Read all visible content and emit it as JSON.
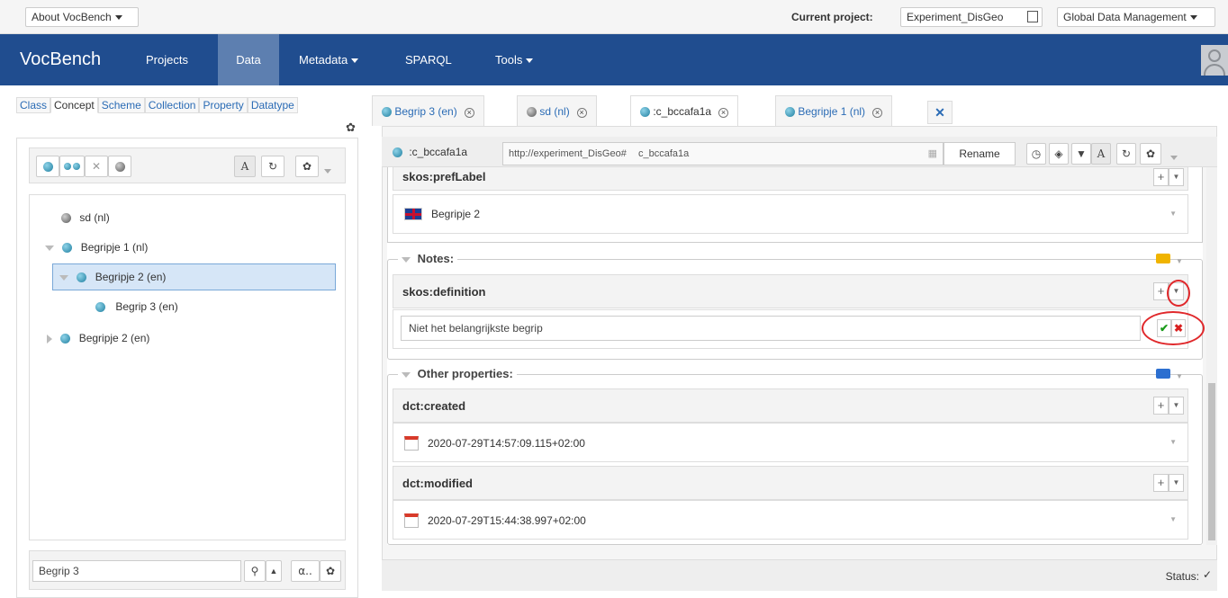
{
  "topbar": {
    "about": "About VocBench",
    "current_project_label": "Current project:",
    "current_project": "Experiment_DisGeo",
    "global_data": "Global Data Management"
  },
  "nav": {
    "brand": "VocBench",
    "projects": "Projects",
    "data": "Data",
    "metadata": "Metadata",
    "sparql": "SPARQL",
    "tools": "Tools"
  },
  "left": {
    "tabs": [
      "Class",
      "Concept",
      "Scheme",
      "Collection",
      "Property",
      "Datatype"
    ],
    "active_tab": "Concept",
    "tree": [
      {
        "label": "sd (nl)"
      },
      {
        "label": "Begripje 1 (nl)"
      },
      {
        "label": "Begripje 2 (en)"
      },
      {
        "label": "Begrip 3 (en)"
      },
      {
        "label": "Begripje 2 (en)"
      }
    ],
    "search_value": "Begrip 3",
    "alpha_label": "α.."
  },
  "right": {
    "tabs": [
      {
        "label": "Begrip 3 (en)"
      },
      {
        "label": "sd (nl)"
      },
      {
        "label": ":c_bccafa1a"
      },
      {
        "label": "Begripje 1 (nl)"
      }
    ],
    "header": {
      "resource": ":c_bccafa1a",
      "namespace": "http://experiment_DisGeo#",
      "local_name": "c_bccafa1a",
      "rename": "Rename"
    },
    "pref_label": {
      "prop": "skos:prefLabel",
      "value": "Begripje 2"
    },
    "notes": {
      "legend": "Notes:",
      "prop": "skos:definition",
      "input_value": "Niet het belangrijkste begrip"
    },
    "other": {
      "legend": "Other properties:",
      "created_prop": "dct:created",
      "created_value": "2020-07-29T14:57:09.115+02:00",
      "modified_prop": "dct:modified",
      "modified_value": "2020-07-29T15:44:38.997+02:00"
    },
    "status_label": "Status:"
  },
  "colors": {
    "navbar": "#204d8f",
    "nav_active": "#5d7fb0",
    "link": "#2a6bb5",
    "annotation_red": "#e0282b"
  }
}
